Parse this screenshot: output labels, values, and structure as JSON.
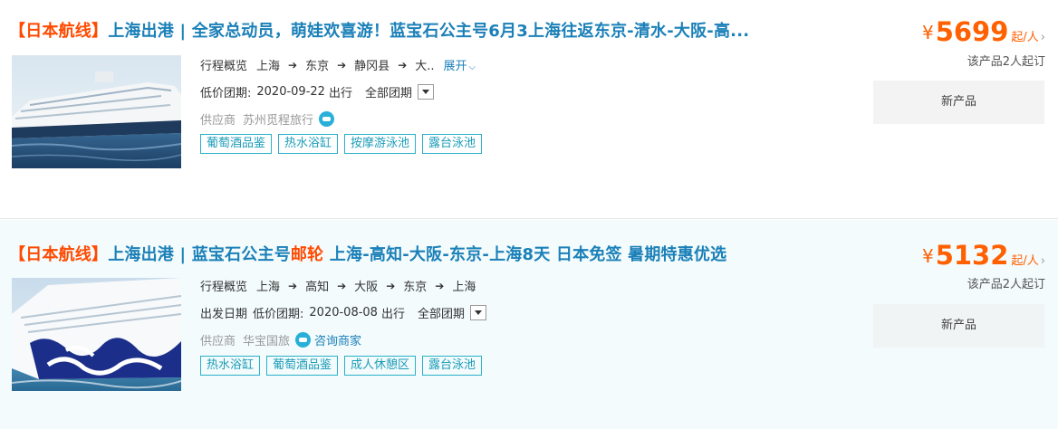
{
  "products": [
    {
      "title_tag": "【日本航线】",
      "title_main": "上海出港 | 全家总动员，萌娃欢喜游！蓝宝石公主号6月3上海往返东京-清水-大阪-高...",
      "itinerary_label": "行程概览",
      "ports": [
        "上海",
        "东京",
        "静冈县",
        "大.."
      ],
      "expand_label": "展开",
      "date_label": "低价团期:",
      "date_value": "2020-09-22",
      "depart_label": "出行",
      "group_select": "全部团期",
      "supplier_label": "供应商",
      "supplier_name": "苏州觅程旅行",
      "tags": [
        "葡萄酒品鉴",
        "热水浴缸",
        "按摩游泳池",
        "露台泳池"
      ],
      "price_symbol": "¥",
      "price": "5699",
      "price_unit": "起/人",
      "price_chevron": "›",
      "min_people": "该产品2人起订",
      "status_button": "新产品"
    },
    {
      "title_tag": "【日本航线】",
      "title_main_a": "上海出港 | 蓝宝石公主号",
      "title_highlight": "邮轮",
      "title_main_b": " 上海-高知-大阪-东京-上海8天 日本免签 暑期特惠优选",
      "itinerary_label": "行程概览",
      "ports": [
        "上海",
        "高知",
        "大阪",
        "东京",
        "上海"
      ],
      "date_prefix": "出发日期",
      "date_label": "低价团期:",
      "date_value": "2020-08-08",
      "depart_label": "出行",
      "group_select": "全部团期",
      "supplier_label": "供应商",
      "supplier_name": "华宝国旅",
      "consult_label": "咨询商家",
      "tags": [
        "热水浴缸",
        "葡萄酒品鉴",
        "成人休憩区",
        "露台泳池"
      ],
      "price_symbol": "¥",
      "price": "5132",
      "price_unit": "起/人",
      "price_chevron": "›",
      "min_people": "该产品2人起订",
      "status_button": "新产品"
    }
  ],
  "icons": {
    "arrow": "arrow-right-icon",
    "chevron": "chevron-down-icon",
    "chat": "chat-icon",
    "dropdown": "dropdown-icon"
  },
  "colors": {
    "title_blue": "#1b80b8",
    "accent_orange": "#ff4a00",
    "price_orange": "#ff6000",
    "tag_border": "#2ab0c9"
  }
}
